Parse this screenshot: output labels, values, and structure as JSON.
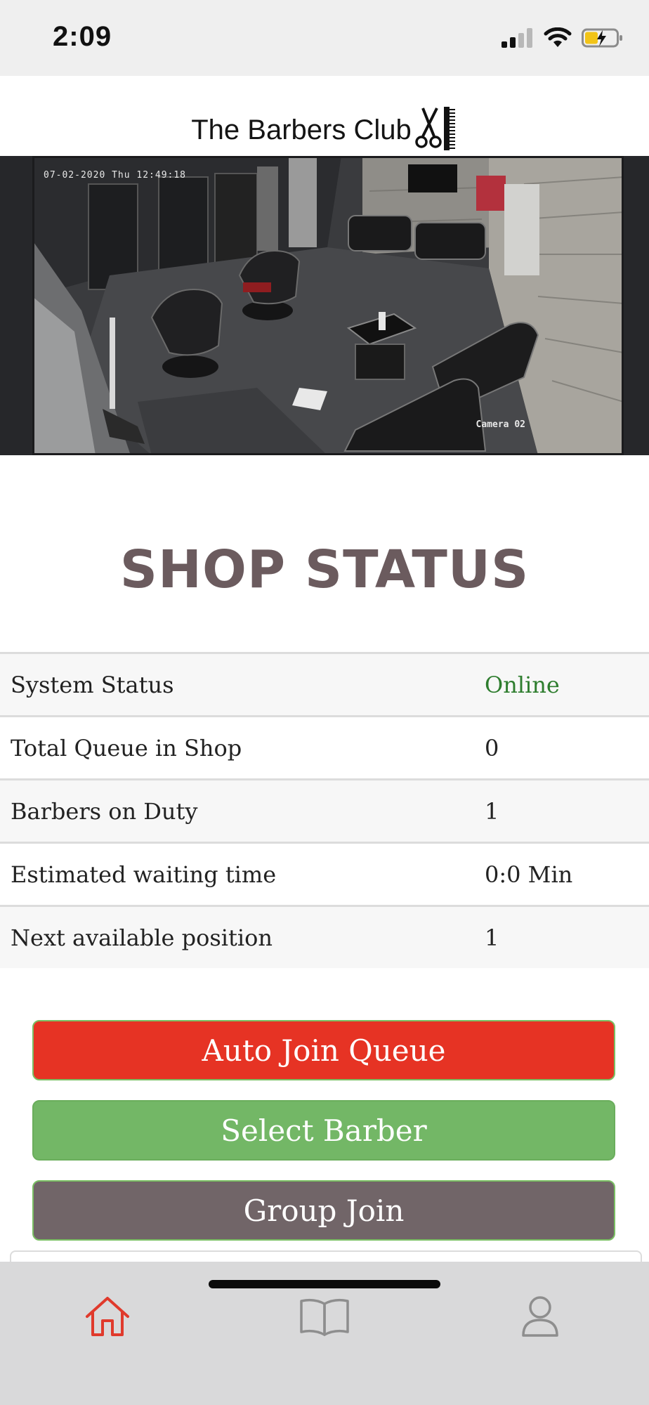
{
  "status_bar": {
    "time": "2:09",
    "icons": [
      "cellular-signal-icon",
      "wifi-icon",
      "battery-charging-icon"
    ]
  },
  "header": {
    "brand": "The Barbers Club",
    "logo_icon": "scissors-comb-icon"
  },
  "camera": {
    "timestamp": "07-02-2020 Thu 12:49:18",
    "label": "Camera 02"
  },
  "shop_status": {
    "title": "SHOP STATUS",
    "rows": [
      {
        "label": "System Status",
        "value": "Online"
      },
      {
        "label": "Total Queue in Shop",
        "value": "0"
      },
      {
        "label": "Barbers on Duty",
        "value": "1"
      },
      {
        "label": "Estimated waiting time",
        "value": "0:0 Min"
      },
      {
        "label": "Next available position",
        "value": "1"
      }
    ]
  },
  "actions": {
    "auto_join": "Auto Join Queue",
    "select_barber": "Select Barber",
    "group_join": "Group Join"
  },
  "bottom_nav": {
    "items": [
      {
        "icon": "home-icon",
        "active": true
      },
      {
        "icon": "book-icon",
        "active": false
      },
      {
        "icon": "user-icon",
        "active": false
      }
    ]
  },
  "colors": {
    "accent_red": "#e63324",
    "accent_green": "#73b766",
    "accent_gray": "#716568",
    "online_green": "#2e7d2e",
    "title": "#6b5b5e"
  }
}
